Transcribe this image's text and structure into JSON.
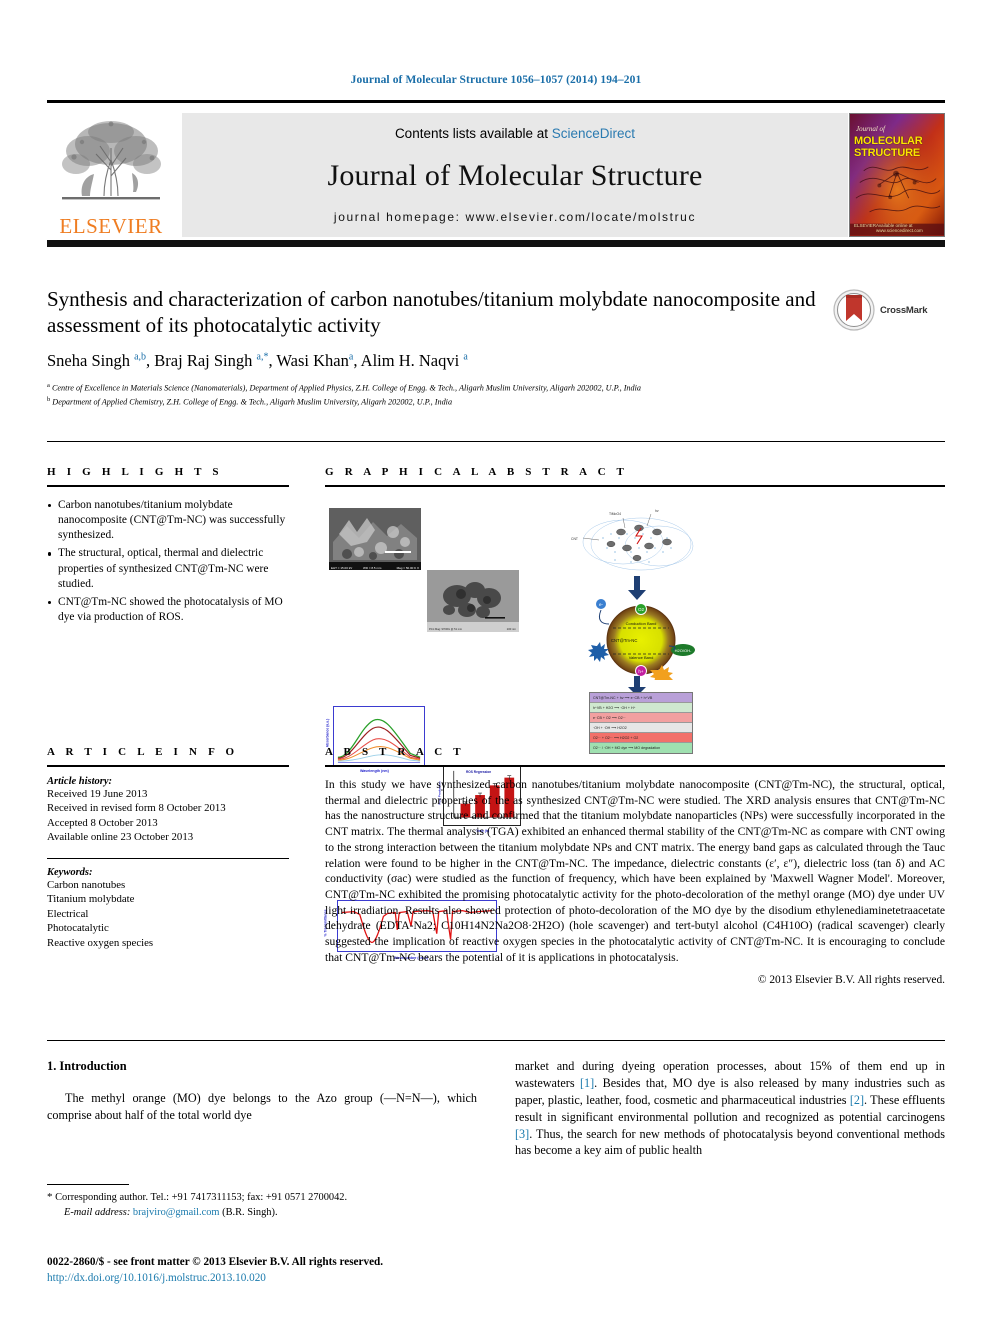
{
  "running_head": "Journal of Molecular Structure 1056–1057 (2014) 194–201",
  "masthead": {
    "contents_prefix": "Contents lists available at ",
    "sciencedirect": "ScienceDirect",
    "journal_name": "Journal of Molecular Structure",
    "homepage": "journal homepage: www.elsevier.com/locate/molstruc",
    "publisher": "ELSEVIER",
    "cover": {
      "journal_of": "Journal of",
      "title_line1": "MOLECULAR",
      "title_line2": "STRUCTURE",
      "bottom_left": "ELSEVIER",
      "bottom_right": "Available online at www.sciencedirect.com"
    }
  },
  "article": {
    "title": "Synthesis and characterization of carbon nanotubes/titanium molybdate nanocomposite and assessment of its photocatalytic activity",
    "crossmark_label": "CrossMark",
    "authors_html": "Sneha Singh <sup>a,b</sup>, Braj Raj Singh <sup>a,*</sup>, Wasi Khan<sup>a</sup>, Alim H. Naqvi <sup>a</sup>",
    "affiliation_a": "Centre of Excellence in Materials Science (Nanomaterials), Department of Applied Physics, Z.H. College of Engg. & Tech., Aligarh Muslim University, Aligarh 202002, U.P., India",
    "affiliation_b": "Department of Applied Chemistry, Z.H. College of Engg. & Tech., Aligarh Muslim University, Aligarh 202002, U.P., India"
  },
  "highlights": {
    "heading": "H I G H L I G H T S",
    "items": [
      "Carbon nanotubes/titanium molybdate nanocomposite (CNT@Tm-NC) was successfully synthesized.",
      "The structural, optical, thermal and dielectric properties of synthesized CNT@Tm-NC were studied.",
      "CNT@Tm-NC showed the photocatalysis of MO dye via production of ROS."
    ]
  },
  "graphical_abstract": {
    "heading": "G R A P H I C A L   A B S T R A C T",
    "panels": {
      "sem_caption_left": "EHT = 15.00 kV",
      "sem_caption_mid": "WD = 8.5 mm",
      "sem_caption_right": "Mag = 50.00 K X",
      "tem_caption_left": "Print Mag: 97000x @ 51 mm",
      "tem_caption_right": "100 nm",
      "uvvis_xlabel": "Wavelength (nm)",
      "uvvis_ylabel": "Absorbance (a.u.)",
      "bar_title": "ROS Regression",
      "bar_xlabel": "Time (h)",
      "bar_ylabel": "ROS Production",
      "ftir_xlabel": "Wavenumber (cm-1)",
      "ftir_ylabel": "% Transmittance",
      "schematic_cnt": "CNT",
      "schematic_np": "TiMoO4",
      "schematic_hv": "hv",
      "core_label": "CNT@Tm-NC",
      "band_conduction": "Conduction Band",
      "band_valence": "Valence Band",
      "badge_a": "e-",
      "badge_b": "h+",
      "badge_c": "O2",
      "badge_d": "OH",
      "badge_e": "ROS",
      "scavenger": "H2O / OH-"
    },
    "reactions": [
      "CNT@Tm-NC + hv  ⟶  e⁻CB + h⁺VB",
      "h⁺VB + H2O  ⟶  ·OH + H⁺",
      "e⁻CB + O2  ⟶  O2·⁻",
      "·OH + ·OH  ⟶  H2O2",
      "O2·⁻ + O2·⁻  ⟶  H2O2 + O2",
      "O2·⁻ / ·OH + MO dye  ⟶  MO degradation"
    ]
  },
  "article_info": {
    "heading": "A R T I C L E   I N F O",
    "history_label": "Article history:",
    "history": [
      "Received 19 June 2013",
      "Received in revised form 8 October 2013",
      "Accepted 8 October 2013",
      "Available online 23 October 2013"
    ],
    "keywords_label": "Keywords:",
    "keywords": [
      "Carbon nanotubes",
      "Titanium molybdate",
      "Electrical",
      "Photocatalytic",
      "Reactive oxygen species"
    ]
  },
  "abstract": {
    "heading": "A B S T R A C T",
    "text": "In this study we have synthesized carbon nanotubes/titanium molybdate nanocomposite (CNT@Tm-NC), the structural, optical, thermal and dielectric properties of the as synthesized CNT@Tm-NC were studied. The XRD analysis ensures that CNT@Tm-NC has the nanostructure structure and confirmed that the titanium molybdate nanoparticles (NPs) were successfully incorporated in the CNT matrix. The thermal analysis (TGA) exhibited an enhanced thermal stability of the CNT@Tm-NC as compare with CNT owing to the strong interaction between the titanium molybdate NPs and CNT matrix. The energy band gaps as calculated through the Tauc relation were found to be higher in the CNT@Tm-NC. The impedance, dielectric constants (ε′, ε″), dielectric loss (tan δ) and AC conductivity (σac) were studied as the function of frequency, which have been explained by 'Maxwell Wagner Model'. Moreover, CNT@Tm-NC exhibited the promising photocatalytic activity for the photo-decoloration of the methyl orange (MO) dye under UV light irradiation. Results also showed protection of photo-decoloration of the MO dye by the disodium ethylenediaminetetraacetate dehydrate (EDTA-Na2; C10H14N2Na2O8·2H2O) (hole scavenger) and tert-butyl alcohol (C4H10O) (radical scavenger) clearly suggested the implication of reactive oxygen species in the photocatalytic activity of CNT@Tm-NC. It is encouraging to conclude that CNT@Tm-NC bears the potential of it is applications in photocatalysis.",
    "copyright": "© 2013 Elsevier B.V. All rights reserved."
  },
  "body": {
    "section_heading": "1. Introduction",
    "left_paragraph": "The methyl orange (MO) dye belongs to the Azo group (—N=N—), which comprise about half of the total world dye",
    "right_paragraph_parts": [
      "market and during dyeing operation processes, about 15% of them end up in wastewaters ",
      "[1]",
      ". Besides that, MO dye is also released by many industries such as paper, plastic, leather, food, cosmetic and pharmaceutical industries ",
      "[2]",
      ". These effluents result in significant environmental pollution and recognized as potential carcinogens ",
      "[3]",
      ". Thus, the search for new methods of photocatalysis beyond conventional methods has become a key aim of public health"
    ]
  },
  "footer": {
    "corresponding_star": "*",
    "corresponding": "Corresponding author. Tel.: +91 7417311153; fax: +91 0571 2700042.",
    "email_label": "E-mail address:",
    "email": "brajviro@gmail.com",
    "email_owner": "(B.R. Singh).",
    "issn_line": "0022-2860/$ - see front matter © 2013 Elsevier B.V. All rights reserved.",
    "doi": "http://dx.doi.org/10.1016/j.molstruc.2013.10.020"
  },
  "colors": {
    "link": "#1a7aad",
    "elsevier_orange": "#ef7d22",
    "sciencedirect": "#2a7ab0"
  }
}
